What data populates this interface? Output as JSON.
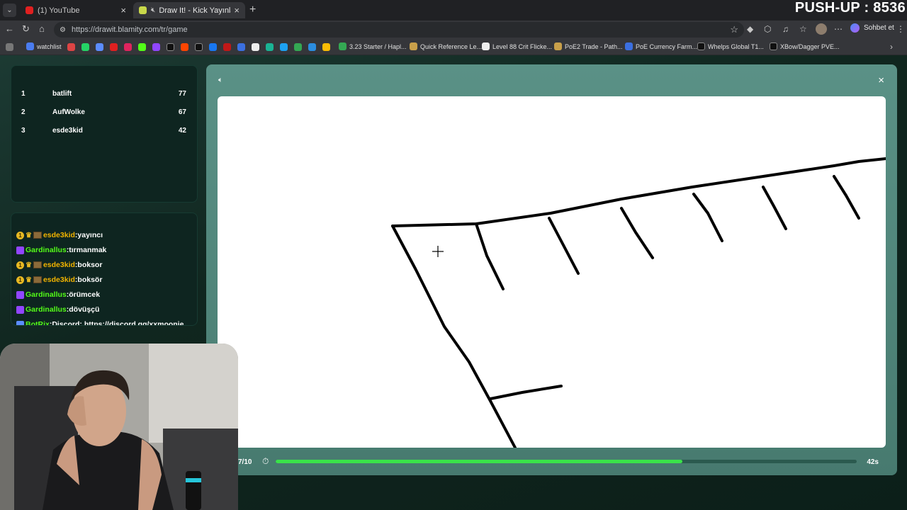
{
  "browser": {
    "tabs": [
      {
        "title": "(1) YouTube",
        "active": false
      },
      {
        "title": "Draw It! - Kick Yayınları İçin Ç",
        "active": true
      }
    ],
    "url": "https://drawit.blamity.com/tr/game",
    "chat_button": "Sohbet et",
    "bookmarks": [
      "watchlist",
      "3.23 Starter / Hapl...",
      "Quick Reference Le...",
      "Level 88 Crit Flicke...",
      "PoE2 Trade - Path...",
      "PoE Currency Farm...",
      "Whelps Global T1...",
      "XBow/Dagger PVE..."
    ]
  },
  "overlay": {
    "pushup": "PUSH-UP : 8536"
  },
  "leaderboard": [
    {
      "rank": "1",
      "name": "batlift",
      "score": "77"
    },
    {
      "rank": "2",
      "name": "AufWolke",
      "score": "67"
    },
    {
      "rank": "3",
      "name": "esde3kid",
      "score": "42"
    }
  ],
  "chat": [
    {
      "user": "esde3kid",
      "text": ":yayıncı",
      "badges": "gold"
    },
    {
      "user": "Gardinallus",
      "text": ":tırmanmak",
      "badges": "purple"
    },
    {
      "user": "esde3kid",
      "text": ":boksor",
      "badges": "gold"
    },
    {
      "user": "esde3kid",
      "text": ":boksör",
      "badges": "gold"
    },
    {
      "user": "Gardinallus",
      "text": ":örümcek",
      "badges": "purple"
    },
    {
      "user": "Gardinallus",
      "text": ":dövüşçü",
      "badges": "purple"
    },
    {
      "user": "BotRix",
      "text": ":Discord: https://discord.gg/xxmoonie",
      "badges": "bot"
    }
  ],
  "game": {
    "round": "7/10",
    "time_left": "42s",
    "progress": 0.7
  },
  "colors": {
    "progress_fill": "#3ae24a",
    "user_gold": "#f2b400",
    "user_green": "#53fc18"
  }
}
